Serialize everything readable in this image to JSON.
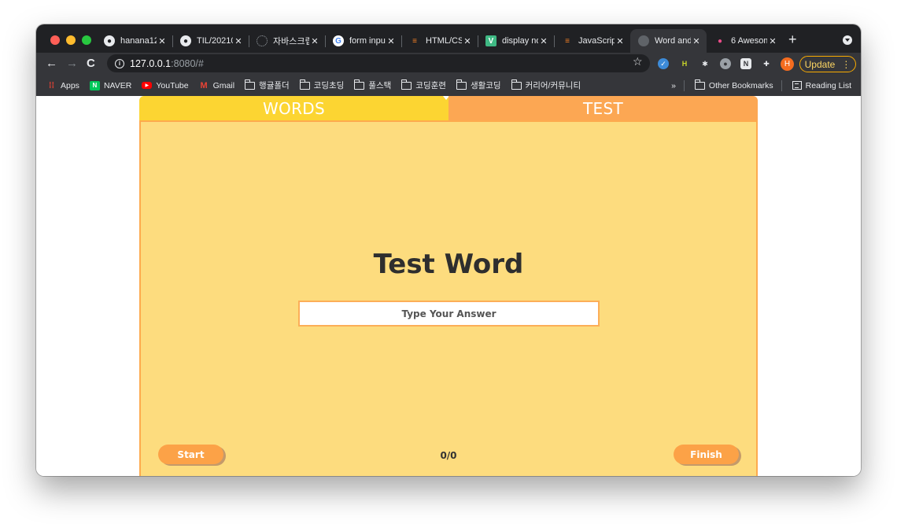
{
  "browser": {
    "traffic_lights": [
      "#ff5f57",
      "#febc2e",
      "#28c840"
    ],
    "tabs": [
      {
        "title": "hanana12",
        "icon": "github-icon"
      },
      {
        "title": "TIL/20210",
        "icon": "github-icon"
      },
      {
        "title": "자바스크립",
        "icon": "loading-icon"
      },
      {
        "title": "form inpu",
        "icon": "google-icon"
      },
      {
        "title": "HTML/CS",
        "icon": "stackoverflow-icon"
      },
      {
        "title": "display no",
        "icon": "vuejs-icon"
      },
      {
        "title": "JavaScrip",
        "icon": "stackoverflow-icon"
      },
      {
        "title": "Word and",
        "icon": "globe-icon",
        "active": true
      },
      {
        "title": "6 Awesom",
        "icon": "dribbble-icon"
      }
    ],
    "close_glyph": "✕",
    "new_tab_glyph": "+",
    "url_host": "127.0.0.1",
    "url_path": ":8080/#",
    "profile_initial": "H",
    "update_label": "Update",
    "update_menu_glyph": "⋮"
  },
  "bookmarks": {
    "apps": "Apps",
    "items": [
      "NAVER",
      "YouTube",
      "Gmail"
    ],
    "folders": [
      "행귤폴더",
      "코딩초딩",
      "풀스택",
      "코딩훈련",
      "생활코딩",
      "커리어/커뮤니티"
    ],
    "overflow": "»",
    "other": "Other Bookmarks",
    "reading_list": "Reading List"
  },
  "app": {
    "tab_words": "WORDS",
    "tab_test": "TEST",
    "title": "Test Word",
    "answer_placeholder": "Type Your Answer",
    "start_label": "Start",
    "finish_label": "Finish",
    "score": "0/0",
    "colors": {
      "words_tab": "#fcd532",
      "test_tab": "#fca753",
      "panel": "#fddc7e",
      "button": "#fca247"
    }
  }
}
